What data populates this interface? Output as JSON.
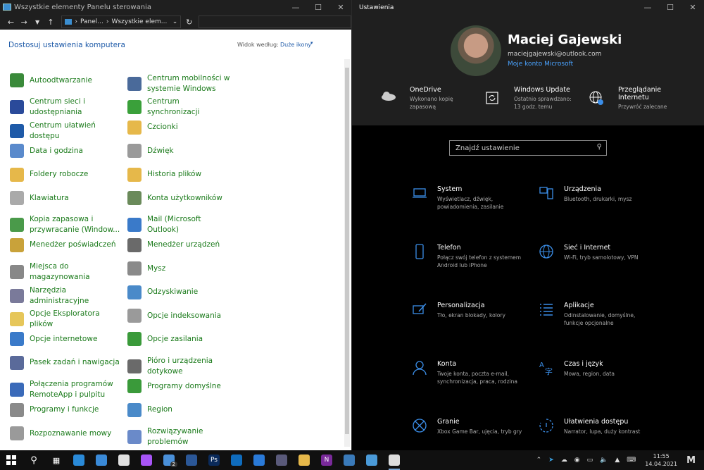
{
  "cp": {
    "title": "Wszystkie elementy Panelu sterowania",
    "crumb1": "Panel...",
    "crumb2": "Wszystkie elem...",
    "heading": "Dostosuj ustawienia komputera",
    "view_label": "Widok według:",
    "view_value": "Duże ikony",
    "left": [
      {
        "label": "Autoodtwarzanie",
        "icon": "autoplay-icon",
        "color": "#3a8a3a"
      },
      {
        "label": "Centrum sieci i udostępniania",
        "icon": "network-icon",
        "color": "#2a4a9a"
      },
      {
        "label": "Centrum ułatwień dostępu",
        "icon": "accessibility-icon",
        "color": "#1e5aa8"
      },
      {
        "label": "Data i godzina",
        "icon": "clock-icon",
        "color": "#5a8acc"
      },
      {
        "label": "Foldery robocze",
        "icon": "folder-icon",
        "color": "#e6b84a"
      },
      {
        "label": "Klawiatura",
        "icon": "keyboard-icon",
        "color": "#aaaaaa"
      },
      {
        "label": "Kopia zapasowa i przywracanie (Window...",
        "icon": "backup-icon",
        "color": "#4a9a4a"
      },
      {
        "label": "Menedżer poświadczeń",
        "icon": "credentials-icon",
        "color": "#c9a23a"
      },
      {
        "label": "Miejsca do magazynowania",
        "icon": "storage-icon",
        "color": "#888888"
      },
      {
        "label": "Narzędzia administracyjne",
        "icon": "admin-tools-icon",
        "color": "#7a7a9a"
      },
      {
        "label": "Opcje Eksploratora plików",
        "icon": "explorer-options-icon",
        "color": "#e6c65a"
      },
      {
        "label": "Opcje internetowe",
        "icon": "internet-options-icon",
        "color": "#3a7ac9"
      },
      {
        "label": "Pasek zadań i nawigacja",
        "icon": "taskbar-icon",
        "color": "#5a6a9a"
      },
      {
        "label": "Połączenia programów RemoteApp i pulpitu",
        "icon": "remoteapp-icon",
        "color": "#3a6ab9"
      },
      {
        "label": "Programy i funkcje",
        "icon": "programs-icon",
        "color": "#8a8a8a"
      },
      {
        "label": "Rozpoznawanie mowy",
        "icon": "microphone-icon",
        "color": "#9a9a9a"
      }
    ],
    "right": [
      {
        "label": "Centrum mobilności w systemie Windows",
        "icon": "mobility-icon",
        "color": "#4a6a9a"
      },
      {
        "label": "Centrum synchronizacji",
        "icon": "sync-icon",
        "color": "#3aa03a"
      },
      {
        "label": "Czcionki",
        "icon": "fonts-icon",
        "color": "#e6b84a"
      },
      {
        "label": "Dźwięk",
        "icon": "speaker-icon",
        "color": "#9a9a9a"
      },
      {
        "label": "Historia plików",
        "icon": "file-history-icon",
        "color": "#e6b84a"
      },
      {
        "label": "Konta użytkowników",
        "icon": "users-icon",
        "color": "#6a8a5a"
      },
      {
        "label": "Mail (Microsoft Outlook)",
        "icon": "mail-icon",
        "color": "#3a7ac9"
      },
      {
        "label": "Menedżer urządzeń",
        "icon": "device-manager-icon",
        "color": "#6a6a6a"
      },
      {
        "label": "Mysz",
        "icon": "mouse-icon",
        "color": "#8a8a8a"
      },
      {
        "label": "Odzyskiwanie",
        "icon": "recovery-icon",
        "color": "#4a8ac9"
      },
      {
        "label": "Opcje indeksowania",
        "icon": "indexing-icon",
        "color": "#9a9a9a"
      },
      {
        "label": "Opcje zasilania",
        "icon": "power-icon",
        "color": "#3a9a3a"
      },
      {
        "label": "Pióro i urządzenia dotykowe",
        "icon": "pen-icon",
        "color": "#6a6a6a"
      },
      {
        "label": "Programy domyślne",
        "icon": "default-programs-icon",
        "color": "#3a9a3a"
      },
      {
        "label": "Region",
        "icon": "region-icon",
        "color": "#4a8ac9"
      },
      {
        "label": "Rozwiązywanie problemów",
        "icon": "troubleshoot-icon",
        "color": "#6a8ac9"
      }
    ]
  },
  "st": {
    "title": "Ustawienia",
    "user_name": "Maciej Gajewski",
    "user_email": "maciejgajewski@outlook.com",
    "account_link": "Moje konto Microsoft",
    "quick": [
      {
        "title": "OneDrive",
        "sub": "Wykonano kopię zapasową",
        "icon": "cloud-icon"
      },
      {
        "title": "Windows Update",
        "sub": "Ostatnio sprawdzano: 13 godz. temu",
        "icon": "update-icon"
      },
      {
        "title": "Przeglądanie Internetu",
        "sub": "Przywróć zalecane",
        "icon": "globe-icon"
      }
    ],
    "search_placeholder": "Znajdź ustawienie",
    "categories": [
      {
        "title": "System",
        "sub": "Wyświetlacz, dźwięk, powiadomienia, zasilanie",
        "icon": "laptop-icon"
      },
      {
        "title": "Urządzenia",
        "sub": "Bluetooth, drukarki, mysz",
        "icon": "devices-icon"
      },
      {
        "title": "Telefon",
        "sub": "Połącz swój telefon z systemem Android lub iPhone",
        "icon": "phone-icon"
      },
      {
        "title": "Sieć i Internet",
        "sub": "Wi-Fi, tryb samolotowy, VPN",
        "icon": "globe-icon"
      },
      {
        "title": "Personalizacja",
        "sub": "Tło, ekran blokady, kolory",
        "icon": "paint-icon"
      },
      {
        "title": "Aplikacje",
        "sub": "Odinstalowanie, domyślne, funkcje opcjonalne",
        "icon": "apps-list-icon"
      },
      {
        "title": "Konta",
        "sub": "Twoje konta, poczta e-mail, synchronizacja, praca, rodzina",
        "icon": "person-icon"
      },
      {
        "title": "Czas i język",
        "sub": "Mowa, region, data",
        "icon": "time-language-icon"
      },
      {
        "title": "Granie",
        "sub": "Xbox Game Bar, ujęcia, tryb gry",
        "icon": "xbox-icon"
      },
      {
        "title": "Ułatwienia dostępu",
        "sub": "Narrator, lupa, duży kontrast",
        "icon": "ease-access-icon"
      }
    ],
    "accent": "#3b8ee8"
  },
  "taskbar": {
    "apps": [
      {
        "name": "edge-icon",
        "color": "#2a8ad8"
      },
      {
        "name": "mail-app-icon",
        "color": "#3a8ad8"
      },
      {
        "name": "slack-icon",
        "color": "#e0e0e0"
      },
      {
        "name": "messenger-icon",
        "color": "#a855f7"
      },
      {
        "name": "files-icon",
        "color": "#4a90d9",
        "badge": "2"
      },
      {
        "name": "word-icon",
        "color": "#2b5797"
      },
      {
        "name": "photoshop-icon",
        "color": "#0a2a5a",
        "text": "Ps"
      },
      {
        "name": "outlook-icon",
        "color": "#0f6cbd"
      },
      {
        "name": "trello-icon",
        "color": "#2a7ad8"
      },
      {
        "name": "calculator-icon",
        "color": "#5a5a7a"
      },
      {
        "name": "explorer-icon",
        "color": "#e6b84a"
      },
      {
        "name": "onenote-icon",
        "color": "#7a2a9a",
        "text": "N"
      },
      {
        "name": "photos-icon",
        "color": "#3a7ab9"
      },
      {
        "name": "control-panel-icon",
        "color": "#4a9ad8"
      },
      {
        "name": "settings-app-icon",
        "color": "#dddddd"
      }
    ],
    "time": "11:55",
    "date": "14.04.2021"
  }
}
